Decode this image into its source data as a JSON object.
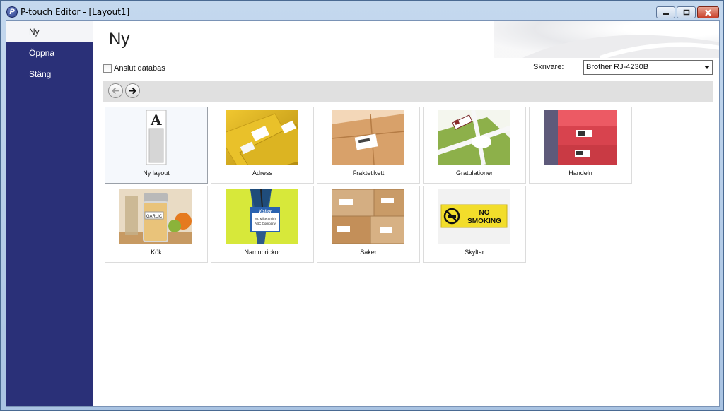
{
  "window": {
    "title": "P-touch Editor - [Layout1]"
  },
  "sidebar": {
    "items": [
      {
        "label": "Ny",
        "active": true
      },
      {
        "label": "Öppna",
        "active": false
      },
      {
        "label": "Stäng",
        "active": false
      }
    ]
  },
  "main": {
    "title": "Ny",
    "connect_db": {
      "label": "Anslut databas",
      "checked": false
    },
    "printer": {
      "label": "Skrivare:",
      "value": "Brother RJ-4230B"
    },
    "tiles": [
      {
        "label": "Ny layout",
        "selected": true
      },
      {
        "label": "Adress"
      },
      {
        "label": "Fraktetikett"
      },
      {
        "label": "Gratulationer"
      },
      {
        "label": "Handeln"
      },
      {
        "label": "Kök"
      },
      {
        "label": "Namnbrickor"
      },
      {
        "label": "Saker"
      },
      {
        "label": "Skyltar"
      }
    ],
    "thumb_text": {
      "new_layout_letter": "A",
      "spice_label": "GARLIC",
      "badge_title": "Visitor",
      "badge_name": "Mr. Mike Smith",
      "badge_company": "ABC Company",
      "sign_line1": "NO",
      "sign_line2": "SMOKING"
    }
  },
  "colors": {
    "sidebar": "#2a3078",
    "window_frame": "#a9c3e2",
    "nav_strip": "#e0e0e0"
  },
  "icons": [
    "app-logo-icon",
    "minimize-icon",
    "maximize-icon",
    "close-icon",
    "back-arrow-icon",
    "forward-arrow-icon",
    "dropdown-arrow-icon"
  ]
}
